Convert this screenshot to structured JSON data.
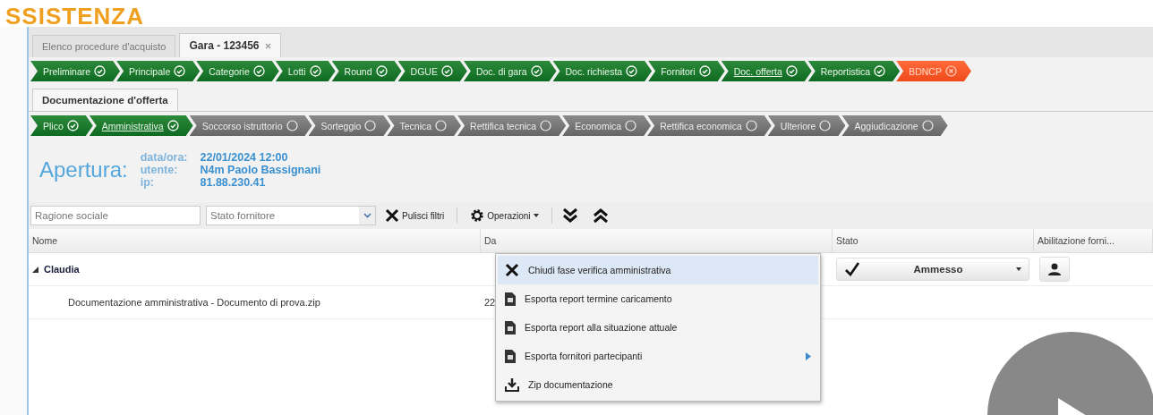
{
  "header": {
    "title": "SSISTENZA"
  },
  "tabs": [
    {
      "label": "Elenco procedure d'acquisto",
      "selected": false,
      "closable": false
    },
    {
      "label": "Gara - 123456",
      "selected": true,
      "closable": true
    }
  ],
  "phases": [
    {
      "label": "Preliminare",
      "kind": "done",
      "selected": false
    },
    {
      "label": "Principale",
      "kind": "done",
      "selected": false
    },
    {
      "label": "Categorie",
      "kind": "done",
      "selected": false
    },
    {
      "label": "Lotti",
      "kind": "done",
      "selected": false
    },
    {
      "label": "Round",
      "kind": "done",
      "selected": false
    },
    {
      "label": "DGUE",
      "kind": "done",
      "selected": false
    },
    {
      "label": "Doc. di gara",
      "kind": "done",
      "selected": false
    },
    {
      "label": "Doc. richiesta",
      "kind": "done",
      "selected": false
    },
    {
      "label": "Fornitori",
      "kind": "done",
      "selected": false
    },
    {
      "label": "Doc. offerta",
      "kind": "done",
      "selected": true
    },
    {
      "label": "Reportistica",
      "kind": "done",
      "selected": false
    },
    {
      "label": "BDNCP",
      "kind": "error",
      "selected": false
    }
  ],
  "section_tab": {
    "label": "Documentazione d'offerta"
  },
  "subphases": [
    {
      "label": "Plico",
      "kind": "done",
      "selected": false
    },
    {
      "label": "Amministrativa",
      "kind": "done",
      "selected": true
    },
    {
      "label": "Soccorso istruttorio",
      "kind": "pending",
      "selected": false
    },
    {
      "label": "Sorteggio",
      "kind": "pending",
      "selected": false
    },
    {
      "label": "Tecnica",
      "kind": "pending",
      "selected": false
    },
    {
      "label": "Rettifica tecnica",
      "kind": "pending",
      "selected": false
    },
    {
      "label": "Economica",
      "kind": "pending",
      "selected": false
    },
    {
      "label": "Rettifica economica",
      "kind": "pending",
      "selected": false
    },
    {
      "label": "Ulteriore",
      "kind": "pending",
      "selected": false
    },
    {
      "label": "Aggiudicazione",
      "kind": "pending",
      "selected": false
    }
  ],
  "opening": {
    "title": "Apertura:",
    "fields": [
      {
        "label": "data/ora:",
        "value": "22/01/2024 12:00"
      },
      {
        "label": "utente:",
        "value": "N4m Paolo Bassignani"
      },
      {
        "label": "ip:",
        "value": "81.88.230.41"
      }
    ]
  },
  "filters": {
    "company": {
      "placeholder": "Ragione sociale"
    },
    "status": {
      "placeholder": "Stato fornitore"
    },
    "clear": "Pulisci filtri",
    "operations": "Operazioni"
  },
  "table": {
    "columns": [
      "Nome",
      "Da",
      "Stato",
      "Abilitazione forni..."
    ],
    "rows": [
      {
        "kind": "group",
        "name": "Claudia",
        "expanded": true,
        "status": "Ammesso"
      },
      {
        "kind": "file",
        "name": "Documentazione amministrativa - Documento di prova.zip",
        "date": "22"
      }
    ]
  },
  "menu": {
    "items": [
      {
        "label": "Chiudi fase verifica amministrativa",
        "kind": "close",
        "selected": true,
        "submenu": false
      },
      {
        "label": "Esporta report termine caricamento",
        "kind": "document",
        "selected": false,
        "submenu": false
      },
      {
        "label": "Esporta report alla situazione attuale",
        "kind": "document",
        "selected": false,
        "submenu": false
      },
      {
        "label": "Esporta fornitori partecipanti",
        "kind": "document",
        "selected": false,
        "submenu": true
      },
      {
        "label": "Zip documentazione",
        "kind": "download",
        "selected": false,
        "submenu": false
      }
    ]
  }
}
